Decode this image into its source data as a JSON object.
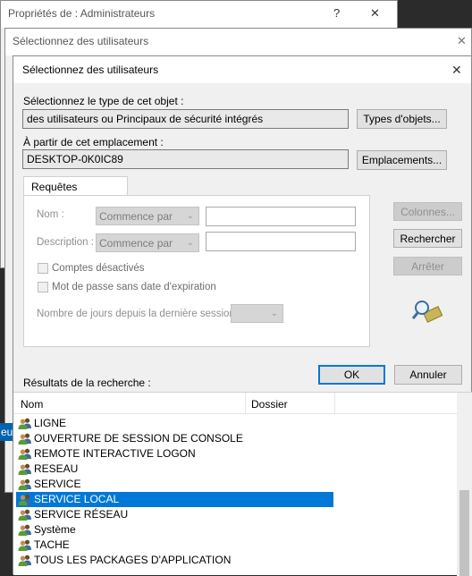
{
  "colors": {
    "accent": "#0078d7",
    "window_bg": "#f0f0f0",
    "dark_bg": "#2b2b2b"
  },
  "window1": {
    "title": "Propriétés de : Administrateurs",
    "help": "?",
    "close": "✕"
  },
  "window2": {
    "title": "Sélectionnez des utilisateurs",
    "close": "✕"
  },
  "left_stub": "eu",
  "dialog": {
    "title": "Sélectionnez des utilisateurs",
    "close": "✕",
    "object_type_label": "Sélectionnez le type de cet objet :",
    "object_type_value": "des utilisateurs ou Principaux de sécurité intégrés",
    "object_types_button": "Types d'objets...",
    "location_label": "À partir de cet emplacement :",
    "location_value": "DESKTOP-0K0IC89",
    "locations_button": "Emplacements...",
    "tab_common_queries": "Requêtes communes",
    "name_label": "Nom :",
    "name_op": "Commence par",
    "description_label": "Description :",
    "description_op": "Commence par",
    "disabled_accounts": "Comptes désactivés",
    "non_expiring_pw": "Mot de passe sans date d'expiration",
    "days_since_login": "Nombre de jours depuis la dernière session :",
    "columns_button": "Colonnes...",
    "search_button": "Rechercher",
    "stop_button": "Arrêter",
    "ok_button": "OK",
    "cancel_button": "Annuler",
    "results_label": "Résultats de la recherche :"
  },
  "results": {
    "columns": [
      "Nom",
      "Dossier"
    ],
    "rows": [
      "LIGNE",
      "OUVERTURE DE SESSION DE CONSOLE",
      "REMOTE INTERACTIVE LOGON",
      "RESEAU",
      "SERVICE",
      "SERVICE LOCAL",
      "SERVICE RÉSEAU",
      "Système",
      "TACHE",
      "TOUS LES PACKAGES D'APPLICATION"
    ],
    "selected_index": 5
  }
}
